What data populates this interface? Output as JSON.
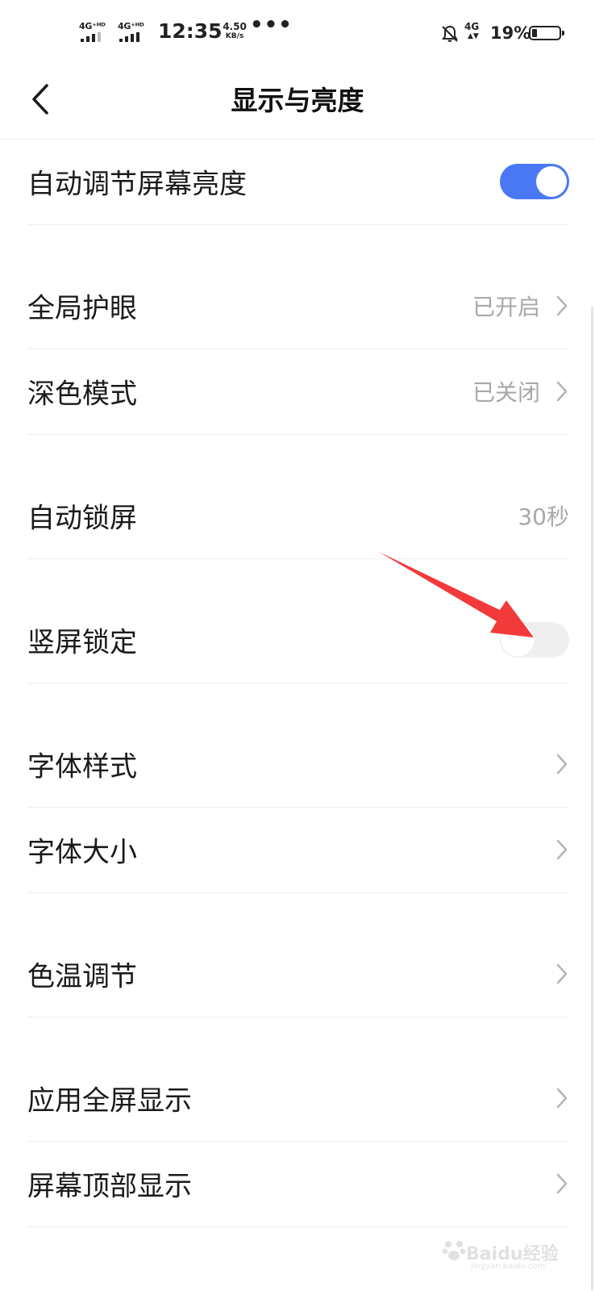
{
  "status_bar": {
    "sim1": "4G⁺ᴴᴰ",
    "sim2": "4G⁺ᴴᴰ",
    "time": "12:35",
    "speed_value": "4.50",
    "speed_unit": "KB/s",
    "more": "•••",
    "data_type": "4G",
    "battery_percent": "19%",
    "battery_level": 0.19,
    "icons": [
      "signal-icon",
      "signal-icon",
      "mute-bell-icon",
      "battery-icon"
    ]
  },
  "header": {
    "back_icon": "chevron-left-icon",
    "title": "显示与亮度"
  },
  "settings": [
    {
      "label": "自动调节屏幕亮度",
      "control": "toggle",
      "state": "on"
    },
    {
      "label": "全局护眼",
      "value": "已开启",
      "control": "chevron"
    },
    {
      "label": "深色模式",
      "value": "已关闭",
      "control": "chevron"
    },
    {
      "label": "自动锁屏",
      "value": "30秒",
      "control": "none"
    },
    {
      "label": "竖屏锁定",
      "control": "toggle",
      "state": "off"
    },
    {
      "label": "字体样式",
      "control": "chevron"
    },
    {
      "label": "字体大小",
      "control": "chevron"
    },
    {
      "label": "色温调节",
      "control": "chevron"
    },
    {
      "label": "应用全屏显示",
      "control": "chevron"
    },
    {
      "label": "屏幕顶部显示",
      "control": "chevron"
    }
  ],
  "annotation": {
    "type": "red-arrow",
    "color": "#f23a3a",
    "points_to": "竖屏锁定 toggle"
  },
  "watermark": {
    "text": "Baidu经验",
    "sub": "jingyan.baidu.com"
  },
  "colors": {
    "accent": "#4a78f5",
    "secondary_text": "#a8a8a8",
    "divider": "#ededed"
  }
}
